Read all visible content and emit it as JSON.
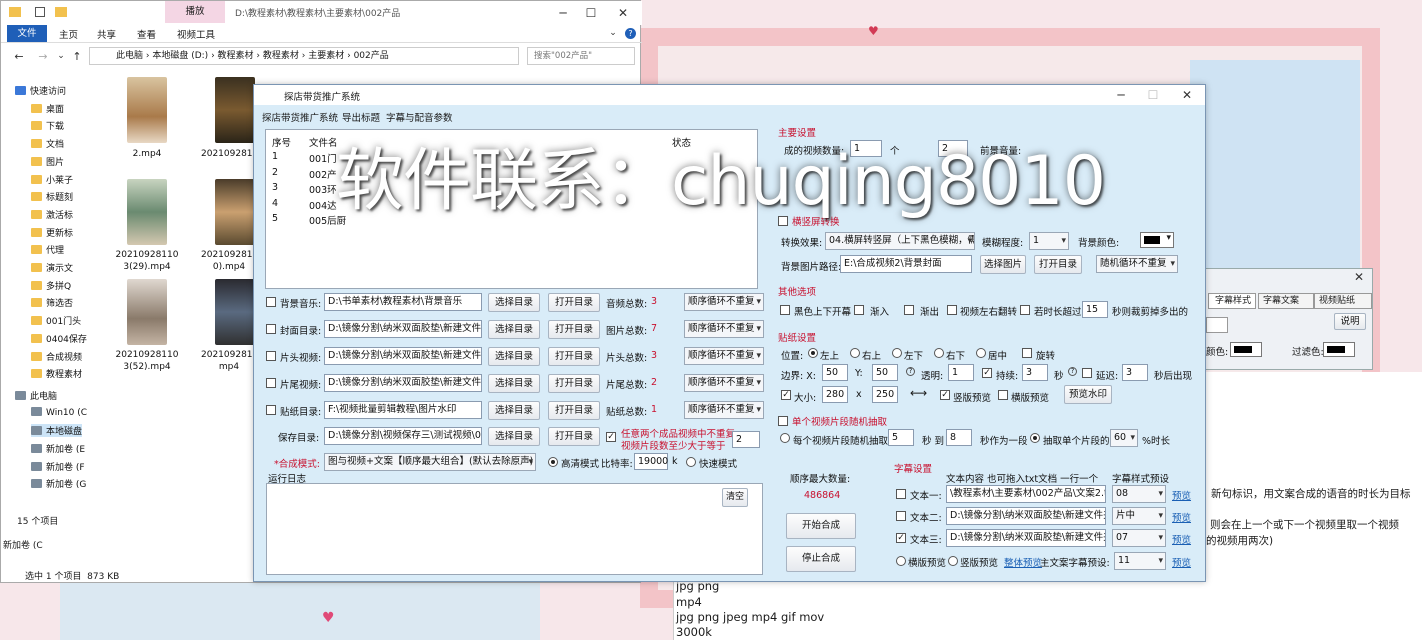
{
  "explorer": {
    "ribbon_tabs": [
      "文件",
      "主页",
      "共享",
      "查看",
      "视频工具"
    ],
    "context_tab": "播放",
    "title": "D:\\教程素材\\教程素材\\主要素材\\002产品",
    "breadcrumb": [
      "此电脑",
      "本地磁盘 (D:)",
      "教程素材",
      "教程素材",
      "主要素材",
      "002产品"
    ],
    "search_placeholder": "搜索\"002产品\"",
    "nav_items": [
      "快速访问",
      "桌面",
      "下载",
      "文档",
      "图片",
      "小莱子",
      "标题刻",
      "激活标",
      "更新标",
      "代理",
      "演示文",
      "多拼Q",
      "筛选否",
      "001门头",
      "0404保存",
      "合成视频",
      "教程素材",
      "此电脑",
      "Win10 (C",
      "本地磁盘",
      "新加卷 (E",
      "新加卷 (F",
      "新加卷 (G"
    ],
    "files": [
      "2.mp4",
      "20210928114).mp4",
      "20210928110 3(29).mp4",
      "20210928113 0).mp4",
      "20210928110 3(52).mp4",
      "20210928110 mp4"
    ],
    "status_count": "15 个项目",
    "status_selected": "选中 1 个项目  873 KB",
    "status_side": "新加卷 (C"
  },
  "app": {
    "title": "探店带货推广系统",
    "menu": [
      "探店带货推广系统",
      "导出标题",
      "字幕与配音参数"
    ],
    "table": {
      "columns": [
        "序号",
        "文件名",
        "",
        "",
        "",
        "状态"
      ],
      "rows": [
        {
          "no": "1",
          "name": "001门"
        },
        {
          "no": "2",
          "name": "002产"
        },
        {
          "no": "3",
          "name": "003环"
        },
        {
          "no": "4",
          "name": "004达"
        },
        {
          "no": "5",
          "name": "005后厨"
        }
      ]
    },
    "rows": [
      {
        "label": "背景音乐:",
        "path": "D:\\书单素材\\教程素材\\背景音乐",
        "count_label": "音频总数:",
        "count": "3",
        "mode": "顺序循环不重复"
      },
      {
        "label": "封面目录:",
        "path": "D:\\镜像分割\\纳米双面胶垫\\新建文件夹",
        "count_label": "图片总数:",
        "count": "7",
        "mode": "顺序循环不重复"
      },
      {
        "label": "片头视频:",
        "path": "D:\\镜像分割\\纳米双面胶垫\\新建文件夹",
        "count_label": "片头总数:",
        "count": "3",
        "mode": "顺序循环不重复"
      },
      {
        "label": "片尾视频:",
        "path": "D:\\镜像分割\\纳米双面胶垫\\新建文件夹",
        "count_label": "片尾总数:",
        "count": "2",
        "mode": "顺序循环不重复"
      },
      {
        "label": "贴纸目录:",
        "path": "F:\\视频批量剪辑教程\\图片水印",
        "count_label": "贴纸总数:",
        "count": "1",
        "mode": "顺序循环不重复"
      }
    ],
    "select_dir": "选择目录",
    "open_dir": "打开目录",
    "save_label": "保存目录:",
    "save_path": "D:\\镜像分割\\视频保存三\\测试视频\\040",
    "repeat_text_1": "任意两个成品视频中不重复",
    "repeat_text_2": "视频片段数至少大于等于",
    "repeat_value": "2",
    "mode_label": "*合成模式:",
    "mode_value": "图与视频+文案【顺序最大组合】(默认去除原声)",
    "hd_mode": "高清模式",
    "bitrate_label": "比特率:",
    "bitrate": "19000",
    "bitrate_unit": "k",
    "fast_mode": "快速模式",
    "log_label": "运行日志",
    "clear": "清空",
    "max_label": "顺序最大数量:",
    "max_value": "486864",
    "start": "开始合成",
    "stop": "停止合成",
    "main_settings": "主要设置",
    "ms_label_a": "成的视频数量:",
    "ms_value_a": "1",
    "ms_unit_a": "个",
    "ms_value_b": "2",
    "ms_label_c": "前景音量:",
    "hv_title": "横竖屏转换",
    "convert_label": "转换效果:",
    "convert_value": "04.横屏转竖屏（上下黑色模糊，需转为)",
    "blur_label": "模糊程度:",
    "blur_value": "1",
    "bgcolor_label": "背景颜色:",
    "bgpath_label": "背景图片路径:",
    "bgpath": "E:\\合成视频2\\背景封面",
    "select_image": "选择图片",
    "random_mode": "随机循环不重复",
    "other_title": "其他选项",
    "other_items": [
      "黑色上下开幕",
      "渐入",
      "渐出",
      "视频左右翻转",
      "若时长超过"
    ],
    "other_seconds": "15",
    "other_suffix": "秒则裁剪掉多出的",
    "sticker_title": "贴纸设置",
    "pos_label": "位置:",
    "pos_options": [
      "左上",
      "右上",
      "左下",
      "右下",
      "居中"
    ],
    "rotate": "旋转",
    "margin_label": "边界: X:",
    "margin_x": "50",
    "margin_y_label": "Y:",
    "margin_y": "50",
    "alpha_label": "透明:",
    "alpha": "1",
    "duration_label": "持续:",
    "duration": "3",
    "duration_unit": "秒",
    "delay_label": "延迟:",
    "delay": "3",
    "delay_suffix": "秒后出现",
    "size_label": "大小:",
    "size_w": "280",
    "size_x": "x",
    "size_h": "250",
    "vertical_preview": "竖版预览",
    "horizontal_preview": "横版预览",
    "preview_watermark": "预览水印",
    "random_title": "单个视频片段随机抽取",
    "random_each": "每个视频片段随机抽取",
    "random_from": "5",
    "random_to_label": "秒 到",
    "random_to": "8",
    "random_unit": "秒作为一段",
    "random_pick": "抽取单个片段的",
    "random_pct": "60",
    "random_pct_unit": "%时长",
    "subtitle_title": "字幕设置",
    "sub_content_label": "文本内容 也可拖入txt文档 一行一个",
    "sub_style_label": "字幕样式预设",
    "subtitles": [
      {
        "label": "文本一:",
        "path": "\\教程素材\\主要素材\\002产品\\文案2.txt",
        "style": "08",
        "checked": false
      },
      {
        "label": "文本二:",
        "path": "D:\\镜像分割\\纳米双面胶垫\\新建文件夹",
        "style": "片中",
        "checked": false
      },
      {
        "label": "文本三:",
        "path": "D:\\镜像分割\\纳米双面胶垫\\新建文件夹",
        "style": "07",
        "checked": true
      }
    ],
    "preview_link": "预览",
    "sub_horizontal": "横版预览",
    "sub_vertical": "竖版预览",
    "sub_preview_link": "整体预览",
    "main_sub_preset": "主文案字幕预设:",
    "main_sub_value": "11"
  },
  "overlay": {
    "text": "软件联系：chuqing8010"
  },
  "bg_window": {
    "tabs": [
      "字幕样式",
      "字幕文案",
      "视频贴纸"
    ],
    "explain": "说明",
    "color_label": "颜色:",
    "filter_label": "过滤色:"
  },
  "bg_text": {
    "line1": "新句标识，用文案合成的语音的时长为目标",
    "line2": "则会在上一个或下一个视频里取一个视频",
    "line3": "的视频用两次)",
    "formats_1": "jpg png",
    "formats_2": "mp4",
    "formats_3": "jpg png jpeg mp4 gif mov",
    "formats_4": "3000k"
  }
}
